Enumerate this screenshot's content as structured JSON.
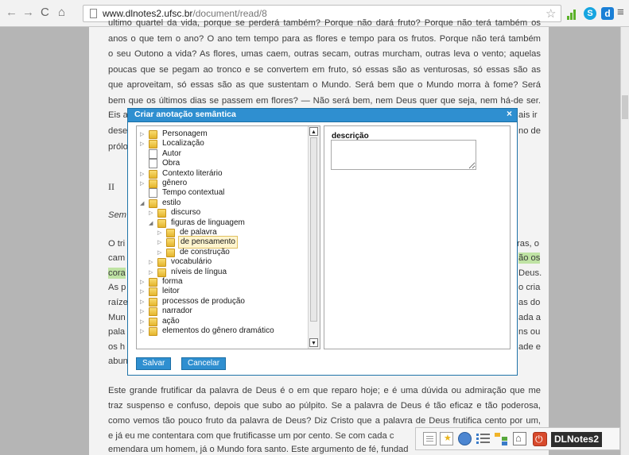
{
  "browser": {
    "url_host": "www.dlnotes2.ufsc.br",
    "url_path": "/document/read/8",
    "colors": {
      "extension_green": "#5cb12a",
      "extension_blue": "#1a7fd6"
    }
  },
  "document": {
    "lines_above": [
      "ultimo quartel da vida, porque se perderá também? Porque não dará fruto? Porque não terá também os",
      "anos o que tem o ano? O ano tem tempo para as flores e tempo para os frutos. Porque não terá também",
      "o seu Outono a vida? As flores, umas caem, outras secam, outras murcham, outras leva o vento; aquelas",
      "poucas que se pegam ao tronco e se convertem em fruto, só essas são as venturosas, só essas são as",
      "que aproveitam, só essas são as que sustentam o Mundo. Será bem que o Mundo morra à fome? Será",
      "bem que os últimos dias se passem em flores? — Não será bem, nem Deus quer que seja, nem há-de ser."
    ],
    "line_eis": "Eis a",
    "line_eis_right": "ais ir",
    "line_dese": "dese",
    "line_dese_right": "no de",
    "line_prol": "prólo",
    "heading_roman": "II",
    "line_sem": "Sem",
    "side_left": [
      "O tri",
      "cam",
      "cora",
      "As p",
      "raíze",
      "Mun",
      "pala",
      "os h",
      "abun"
    ],
    "side_right": [
      "ras, o",
      "ão os",
      "Deus.",
      "o cria",
      "as do",
      "ada a",
      "ns ou",
      "ade e"
    ],
    "lines_below": [
      "Este grande frutificar da palavra de Deus é o em que reparo hoje; e é uma dúvida ou admiração que me",
      "traz suspenso e confuso, depois que subo ao púlpito. Se a palavra de Deus é tão eficaz e tão poderosa,",
      "como vemos tão pouco fruto da palavra de Deus? Diz Cristo que a palavra de Deus frutifica cento por um,",
      "e já eu me contentara com que frutificasse um por cento. Se com cada c",
      "emendara um homem, já o Mundo fora santo. Este argumento de fé, fundad"
    ]
  },
  "dialog": {
    "title": "Criar anotação semântica",
    "close_glyph": "×",
    "description_label": "descrição",
    "description_value": "",
    "save_label": "Salvar",
    "cancel_label": "Cancelar",
    "tree": [
      {
        "label": "Personagem",
        "type": "folder",
        "depth": 0,
        "toggle": "▷"
      },
      {
        "label": "Localização",
        "type": "folder",
        "depth": 0,
        "toggle": "▷"
      },
      {
        "label": "Autor",
        "type": "doc",
        "depth": 0,
        "toggle": ""
      },
      {
        "label": "Obra",
        "type": "doc",
        "depth": 0,
        "toggle": ""
      },
      {
        "label": "Contexto literário",
        "type": "folder",
        "depth": 0,
        "toggle": "▷"
      },
      {
        "label": "gênero",
        "type": "folder",
        "depth": 0,
        "toggle": "▷"
      },
      {
        "label": "Tempo contextual",
        "type": "doc",
        "depth": 0,
        "toggle": ""
      },
      {
        "label": "estilo",
        "type": "folder",
        "depth": 0,
        "toggle": "◢"
      },
      {
        "label": "discurso",
        "type": "folder",
        "depth": 1,
        "toggle": "▷"
      },
      {
        "label": "figuras de linguagem",
        "type": "folder",
        "depth": 1,
        "toggle": "◢"
      },
      {
        "label": "de palavra",
        "type": "folder",
        "depth": 2,
        "toggle": "▷"
      },
      {
        "label": "de pensamento",
        "type": "folder",
        "depth": 2,
        "toggle": "▷",
        "selected": true
      },
      {
        "label": "de construção",
        "type": "folder",
        "depth": 2,
        "toggle": "▷"
      },
      {
        "label": "vocabulário",
        "type": "folder",
        "depth": 1,
        "toggle": "▷"
      },
      {
        "label": "níveis de língua",
        "type": "folder",
        "depth": 1,
        "toggle": "▷"
      },
      {
        "label": "forma",
        "type": "folder",
        "depth": 0,
        "toggle": "▷"
      },
      {
        "label": "leitor",
        "type": "folder",
        "depth": 0,
        "toggle": "▷"
      },
      {
        "label": "processos de produção",
        "type": "folder",
        "depth": 0,
        "toggle": "▷"
      },
      {
        "label": "narrador",
        "type": "folder",
        "depth": 0,
        "toggle": "▷"
      },
      {
        "label": "ação",
        "type": "folder",
        "depth": 0,
        "toggle": "▷"
      },
      {
        "label": "elementos do gênero dramático",
        "type": "folder",
        "depth": 0,
        "toggle": "▷"
      }
    ],
    "colors": {
      "title_bar": "#2f8fd0",
      "button": "#2f8fd0",
      "selection": "#fff5cf"
    }
  },
  "toolbar": {
    "brand": "DLNotes2",
    "icons": [
      "page-icon",
      "note-icon",
      "refresh-icon",
      "list-icon",
      "tree-icon",
      "home-icon",
      "power-icon"
    ]
  },
  "highlight_color": "#bfe3a4"
}
